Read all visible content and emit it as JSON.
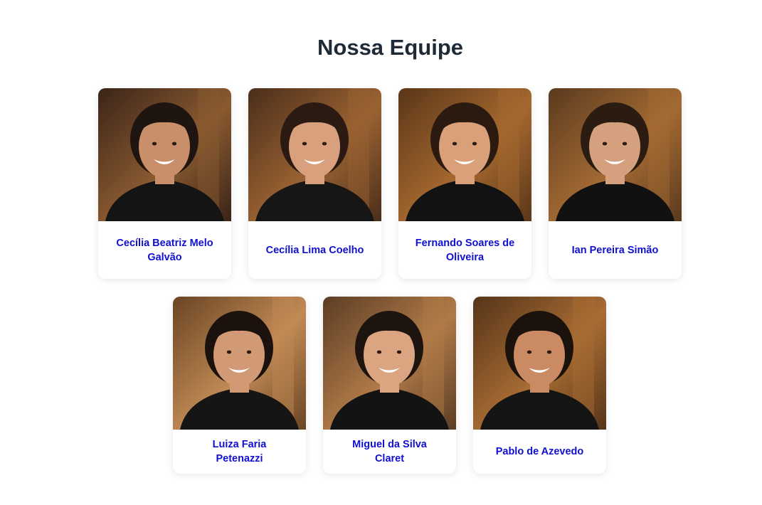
{
  "section": {
    "title": "Nossa Equipe"
  },
  "team": [
    {
      "name": "Cecília Beatriz Melo Galvão",
      "bg": "#8a5a30",
      "bg2": "#3a2418",
      "skin": "#c98e6a",
      "hair": "#1e1410",
      "shirt": "#141414"
    },
    {
      "name": "Cecília Lima Coelho",
      "bg": "#9a6232",
      "bg2": "#4a2e1a",
      "skin": "#d8a07c",
      "hair": "#2b1a12",
      "shirt": "#161616"
    },
    {
      "name": "Fernando Soares de Oliveira",
      "bg": "#a5682f",
      "bg2": "#5a3618",
      "skin": "#d9a07a",
      "hair": "#2a1a10",
      "shirt": "#121212"
    },
    {
      "name": "Ian Pereira Simão",
      "bg": "#a36a33",
      "bg2": "#5b3a1e",
      "skin": "#d5a07e",
      "hair": "#2b1c12",
      "shirt": "#111111"
    },
    {
      "name": "Luiza Faria Petenazzi",
      "bg": "#c08a55",
      "bg2": "#6a4423",
      "skin": "#d29a74",
      "hair": "#1c120d",
      "shirt": "#151515"
    },
    {
      "name": "Miguel da Silva Claret",
      "bg": "#b07a48",
      "bg2": "#5c3d24",
      "skin": "#dba582",
      "hair": "#1d140f",
      "shirt": "#131313"
    },
    {
      "name": "Pablo de Azevedo",
      "bg": "#a86c34",
      "bg2": "#553418",
      "skin": "#c98a64",
      "hair": "#1c120c",
      "shirt": "#141414"
    }
  ]
}
